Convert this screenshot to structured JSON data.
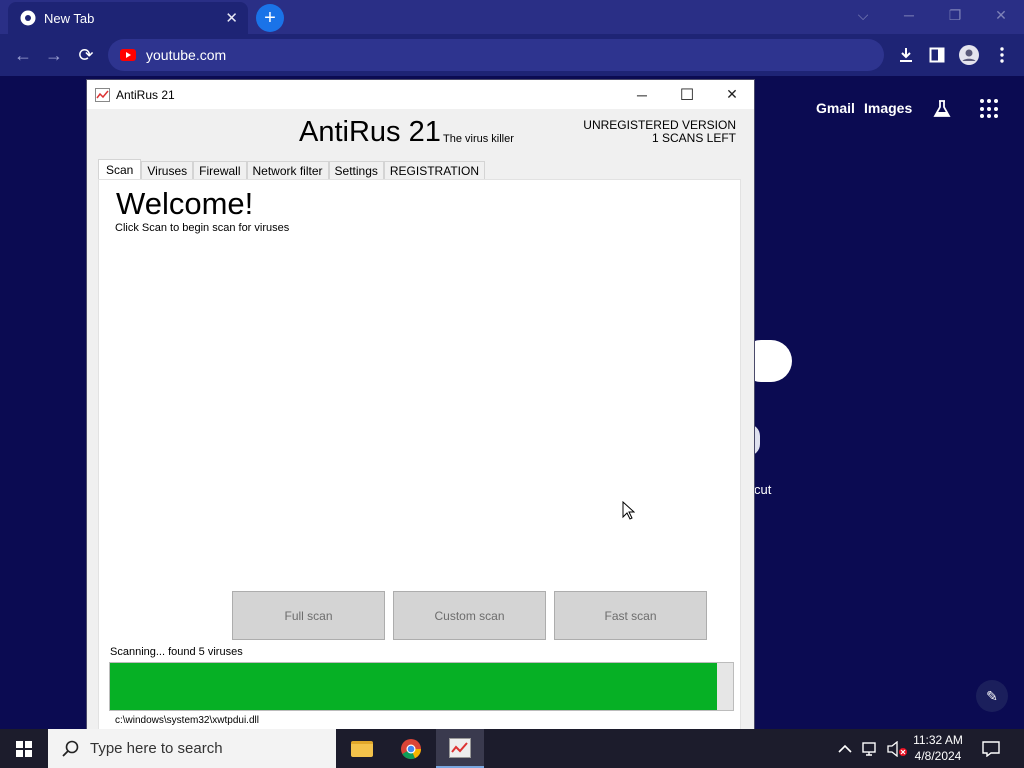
{
  "browser": {
    "tab_title": "New Tab",
    "tab_close": "✕",
    "new_tab": "+",
    "url": "youtube.com",
    "window_controls": {
      "dropdown": "⌵",
      "minimize": "─",
      "restore": "❐",
      "close": "✕"
    },
    "nav": {
      "back": "←",
      "forward": "→",
      "reload": "⟳"
    },
    "toolbar_icons": [
      "download-icon",
      "side-panel-icon",
      "profile-icon",
      "more-icon"
    ]
  },
  "ntp": {
    "gmail": "Gmail",
    "images": "Images",
    "shortcut_label": "cut",
    "edit": "✎"
  },
  "app": {
    "window_title": "AntiRus 21",
    "controls": {
      "minimize": "─",
      "maximize": "☐",
      "close": "✕"
    },
    "brand": "AntiRus 21",
    "tagline": "The virus killer",
    "version_status": "UNREGISTERED VERSION",
    "scans_left": "1 SCANS LEFT",
    "tabs": [
      {
        "label": "Scan",
        "active": true
      },
      {
        "label": "Viruses"
      },
      {
        "label": "Firewall"
      },
      {
        "label": "Network filter"
      },
      {
        "label": "Settings"
      },
      {
        "label": "REGISTRATION"
      }
    ],
    "welcome": "Welcome!",
    "hint": "Click Scan to begin scan for viruses",
    "buttons": {
      "full": "Full scan",
      "custom": "Custom scan",
      "fast": "Fast scan"
    },
    "scan_status": "Scanning... found 5 viruses",
    "progress_percent": 97.5,
    "current_file": "c:\\windows\\system32\\xwtpdui.dll"
  },
  "taskbar": {
    "search_placeholder": "Type here to search",
    "time": "11:32 AM",
    "date": "4/8/2024"
  },
  "colors": {
    "progress": "#06b025",
    "chrome_frame": "#2a2f86",
    "desktop": "#0b0b52"
  }
}
